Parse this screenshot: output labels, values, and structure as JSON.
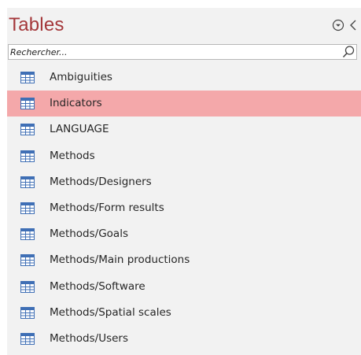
{
  "pane": {
    "title": "Tables",
    "menu_icon": "circle-chevron-down-icon",
    "collapse_icon": "chevron-left-icon"
  },
  "search": {
    "placeholder": "Rechercher...",
    "value": "",
    "icon": "search-icon"
  },
  "items": [
    {
      "label": "Ambiguities",
      "icon": "table-icon",
      "selected": false
    },
    {
      "label": "Indicators",
      "icon": "table-icon",
      "selected": true
    },
    {
      "label": "LANGUAGE",
      "icon": "table-icon",
      "selected": false
    },
    {
      "label": "Methods",
      "icon": "table-icon",
      "selected": false
    },
    {
      "label": "Methods/Designers",
      "icon": "table-icon",
      "selected": false
    },
    {
      "label": "Methods/Form results",
      "icon": "table-icon",
      "selected": false
    },
    {
      "label": "Methods/Goals",
      "icon": "table-icon",
      "selected": false
    },
    {
      "label": "Methods/Main productions",
      "icon": "table-icon",
      "selected": false
    },
    {
      "label": "Methods/Software",
      "icon": "table-icon",
      "selected": false
    },
    {
      "label": "Methods/Spatial scales",
      "icon": "table-icon",
      "selected": false
    },
    {
      "label": "Methods/Users",
      "icon": "table-icon",
      "selected": false
    }
  ],
  "colors": {
    "title": "#a4373a",
    "selected_row": "#f4a8aa",
    "pane_background": "#f2f2f2"
  }
}
